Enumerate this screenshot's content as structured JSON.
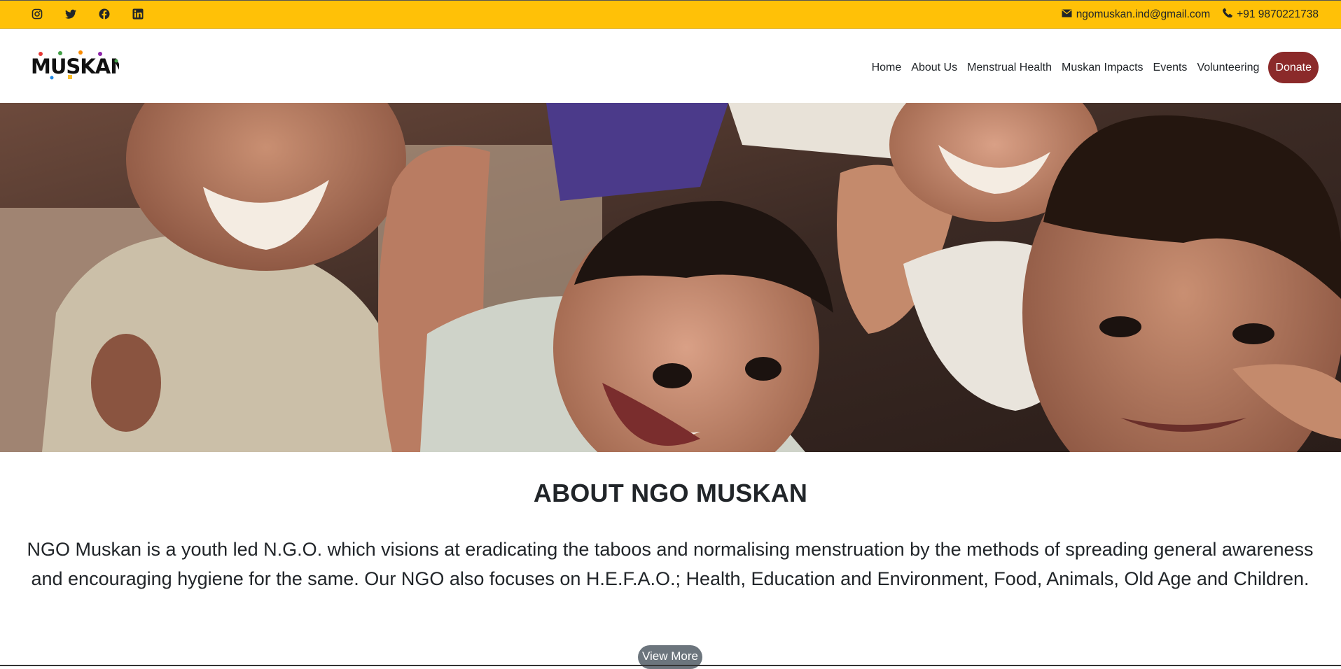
{
  "topbar": {
    "social": [
      {
        "name": "instagram-icon"
      },
      {
        "name": "twitter-icon"
      },
      {
        "name": "facebook-icon"
      },
      {
        "name": "linkedin-icon"
      }
    ],
    "email": "ngomuskan.ind@gmail.com",
    "phone": "+91 9870221738",
    "background": "#ffc107"
  },
  "brand": {
    "logo_text": "MUSKAN"
  },
  "nav": {
    "items": [
      {
        "label": "Home"
      },
      {
        "label": "About Us"
      },
      {
        "label": "Menstrual Health"
      },
      {
        "label": "Muskan Impacts"
      },
      {
        "label": "Events"
      },
      {
        "label": "Volunteering"
      }
    ],
    "donate_label": "Donate",
    "donate_color": "#8b2a2a"
  },
  "about": {
    "title": "ABOUT NGO MUSKAN",
    "text": "NGO Muskan is a youth led N.G.O. which visions at eradicating the taboos and normalising menstruation by the methods of spreading general awareness and encouraging hygiene for the same. Our NGO also focuses on H.E.F.A.O.; Health, Education and Environment, Food, Animals, Old Age and Children.",
    "button_label": "View More"
  }
}
